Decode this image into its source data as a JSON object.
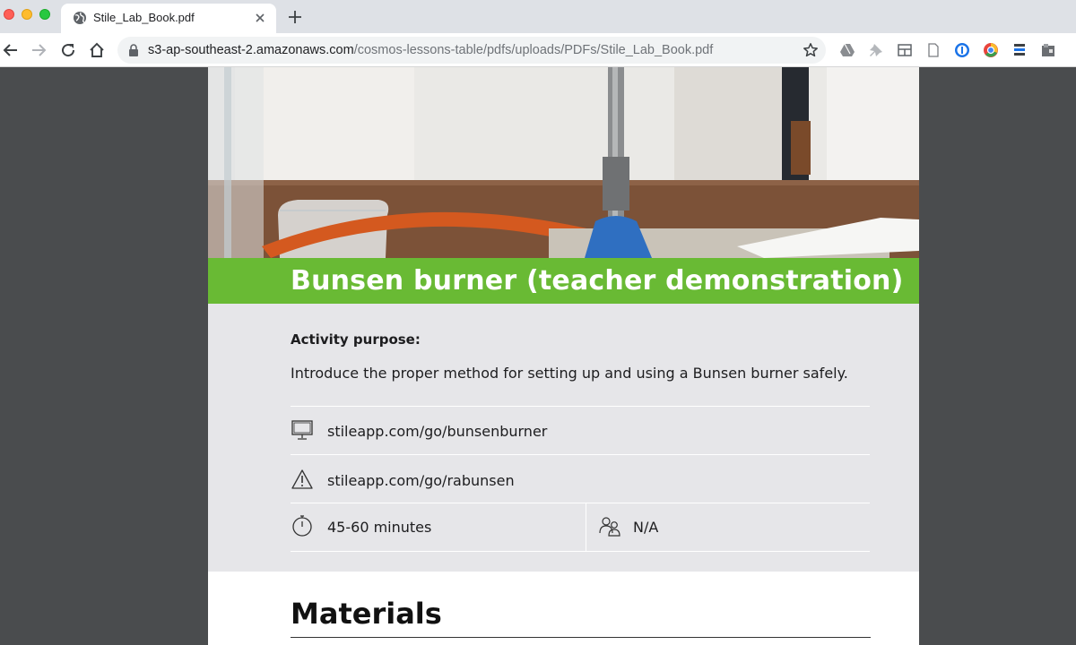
{
  "browser": {
    "tab_title": "Stile_Lab_Book.pdf",
    "url_host": "s3-ap-southeast-2.amazonaws.com",
    "url_path": "/cosmos-lessons-table/pdfs/uploads/PDFs/Stile_Lab_Book.pdf",
    "extensions": [
      "drive-icon",
      "pin-icon",
      "layout-icon",
      "page-icon",
      "password-manager-icon",
      "color-picker-icon",
      "tools-icon",
      "extension-icon"
    ]
  },
  "document": {
    "title": "Bunsen burner (teacher demonstration)",
    "purpose_label": "Activity purpose:",
    "purpose_text": "Introduce the proper method for setting up and using a Bunsen burner safely.",
    "link_interactive": "stileapp.com/go/bunsenburner",
    "link_risk": "stileapp.com/go/rabunsen",
    "duration": "45-60 minutes",
    "group_size": "N/A",
    "materials_heading": "Materials"
  },
  "colors": {
    "banner": "#69ba34",
    "info_panel": "#e6e6e9",
    "background": "#4a4c4e"
  }
}
